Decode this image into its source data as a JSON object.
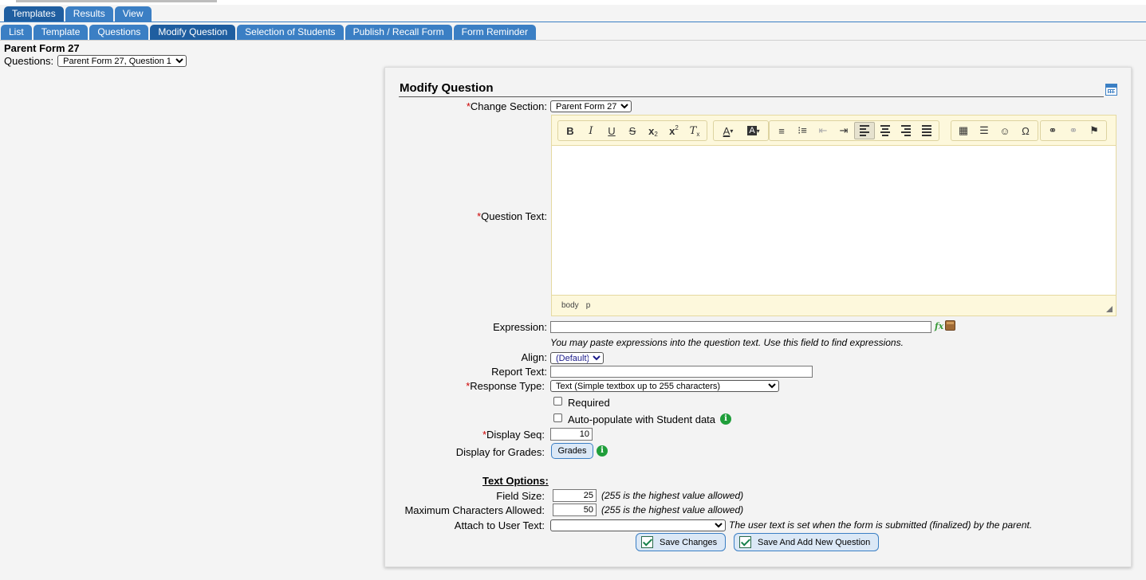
{
  "tabs_row1": [
    "Templates",
    "Results",
    "View"
  ],
  "tabs_row2": [
    "List",
    "Template",
    "Questions",
    "Modify Question",
    "Selection of Students",
    "Publish / Recall Form",
    "Form Reminder"
  ],
  "form_name": "Parent Form 27",
  "questions_label": "Questions:",
  "questions_selected": "Parent Form 27, Question 1",
  "panel": {
    "title": "Modify Question",
    "change_section_label": "Change Section:",
    "change_section_value": "Parent Form 27",
    "question_text_label": "Question Text:",
    "editor_path": [
      "body",
      "p"
    ],
    "expression_label": "Expression:",
    "expression_hint": "You may paste expressions into the question text. Use this field to find expressions.",
    "align_label": "Align:",
    "align_value": "(Default)",
    "report_text_label": "Report Text:",
    "response_type_label": "Response Type:",
    "response_type_value": "Text (Simple textbox up to 255 characters)",
    "required_label": "Required",
    "autopopulate_label": "Auto-populate with Student data",
    "display_seq_label": "Display Seq:",
    "display_seq_value": "10",
    "display_grades_label": "Display for Grades:",
    "grades_button": "Grades",
    "text_options_title": "Text Options:",
    "field_size_label": "Field Size:",
    "field_size_value": "25",
    "field_size_hint": "(255 is the highest value allowed)",
    "max_chars_label": "Maximum Characters Allowed:",
    "max_chars_value": "50",
    "max_chars_hint": "(255 is the highest value allowed)",
    "attach_label": "Attach to User Text:",
    "attach_hint": "The user text is set when the form is submitted (finalized) by the parent.",
    "save_button": "Save Changes",
    "save_add_button": "Save And Add New Question",
    "required_marker": "*"
  },
  "colors": {
    "tab": "#3b7fc4",
    "tab_active": "#1f5ea0",
    "required": "#cc0000",
    "info": "#1f9e3a"
  }
}
